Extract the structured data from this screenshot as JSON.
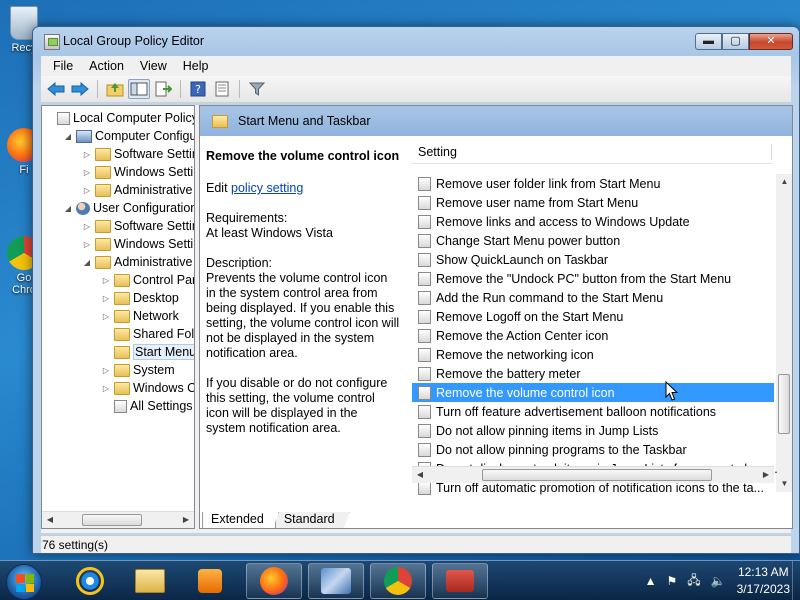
{
  "desktop": {
    "icons": [
      {
        "label": "Recy"
      },
      {
        "label": "Fi"
      },
      {
        "label": "Go Chro"
      }
    ]
  },
  "window": {
    "title": "Local Group Policy Editor",
    "buttons": {
      "minimize": "▬",
      "maximize": "▢",
      "close": "✕"
    }
  },
  "menubar": [
    "File",
    "Action",
    "View",
    "Help"
  ],
  "toolbar": {
    "icons": [
      "back-arrow-icon",
      "forward-arrow-icon",
      "up-folder-icon",
      "show-hide-tree-icon",
      "export-list-icon",
      "help-icon",
      "extended-view-icon",
      "filter-icon"
    ]
  },
  "tree": {
    "items": [
      {
        "label": "Local Computer Policy",
        "icon": "policy",
        "twisty": "",
        "level": 0
      },
      {
        "label": "Computer Configura",
        "icon": "pc",
        "twisty": "◢",
        "level": 1
      },
      {
        "label": "Software Settings",
        "icon": "folder",
        "twisty": "▷",
        "level": 2
      },
      {
        "label": "Windows Setting",
        "icon": "folder",
        "twisty": "▷",
        "level": 2
      },
      {
        "label": "Administrative Te",
        "icon": "folder",
        "twisty": "▷",
        "level": 2
      },
      {
        "label": "User Configuration",
        "icon": "user",
        "twisty": "◢",
        "level": 1
      },
      {
        "label": "Software Settings",
        "icon": "folder",
        "twisty": "▷",
        "level": 2
      },
      {
        "label": "Windows Setting",
        "icon": "folder",
        "twisty": "▷",
        "level": 2
      },
      {
        "label": "Administrative Te",
        "icon": "folder",
        "twisty": "◢",
        "level": 2
      },
      {
        "label": "Control Panel",
        "icon": "folder",
        "twisty": "▷",
        "level": 3
      },
      {
        "label": "Desktop",
        "icon": "folder",
        "twisty": "▷",
        "level": 3
      },
      {
        "label": "Network",
        "icon": "folder",
        "twisty": "▷",
        "level": 3
      },
      {
        "label": "Shared Folder",
        "icon": "folder",
        "twisty": "",
        "level": 3
      },
      {
        "label": "Start Menu ar",
        "icon": "folder",
        "twisty": "",
        "level": 3,
        "selected": true
      },
      {
        "label": "System",
        "icon": "folder",
        "twisty": "▷",
        "level": 3
      },
      {
        "label": "Windows Cor",
        "icon": "folder",
        "twisty": "▷",
        "level": 3
      },
      {
        "label": "All Settings",
        "icon": "policy",
        "twisty": "",
        "level": 3
      }
    ]
  },
  "right_panel": {
    "header": "Start Menu and Taskbar",
    "extended": {
      "policy_title": "Remove the volume control icon",
      "edit_prefix": "Edit ",
      "edit_link": "policy setting",
      "requirements_label": "Requirements:",
      "requirements_value": "At least Windows Vista",
      "description_label": "Description:",
      "description_1": " Prevents the volume control icon in the system control area from being displayed. If you enable this setting, the volume control icon will not be displayed in the system notification area.",
      "description_2": "If you disable or do not configure this setting, the volume control icon will be displayed in the system notification area."
    },
    "list": {
      "column": "Setting",
      "rows": [
        "Remove user folder link from Start Menu",
        "Remove user name from Start Menu",
        "Remove links and access to Windows Update",
        "Change Start Menu power button",
        "Show QuickLaunch on Taskbar",
        "Remove the \"Undock PC\" button from the Start Menu",
        "Add the Run command to the Start Menu",
        "Remove Logoff on the Start Menu",
        "Remove the Action Center icon",
        "Remove the networking icon",
        "Remove the battery meter",
        "Remove the volume control icon",
        "Turn off feature advertisement balloon notifications",
        "Do not allow pinning items in Jump Lists",
        "Do not allow pinning programs to the Taskbar",
        "Do not display or track items in Jump Lists from remote loca...",
        "Turn off automatic promotion of notification icons to the ta..."
      ],
      "selected_index": 11
    },
    "tabs": [
      "Extended",
      "Standard"
    ]
  },
  "status": "76 setting(s)",
  "taskbar": {
    "apps": [
      "internet-explorer-icon",
      "file-explorer-icon",
      "media-player-icon",
      "firefox-icon",
      "network-app-icon",
      "chrome-icon",
      "toolbox-icon"
    ],
    "clock_time": "12:13 AM",
    "clock_date": "3/17/2023"
  },
  "colors": {
    "selection": "#3399ff",
    "header": "#8fb3dc",
    "link": "#0645ad"
  }
}
